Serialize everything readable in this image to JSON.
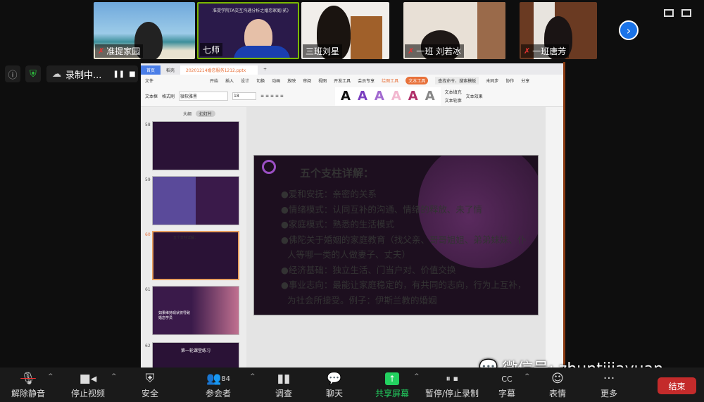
{
  "participants": [
    {
      "name": "准提家园",
      "muted": true
    },
    {
      "name": "七师",
      "muted": false,
      "slide_title": "准提学院TA交互沟通分析之婚恋家庭(贰)"
    },
    {
      "name": "三班刘星",
      "muted": false
    },
    {
      "name": "一班 刘若冰",
      "muted": true
    },
    {
      "name": "一班唐芳",
      "muted": true
    }
  ],
  "recording": {
    "label": "录制中..."
  },
  "wps": {
    "tabs": [
      "首页",
      "稻壳",
      "20201214婚恋服务1212.pptx"
    ],
    "menu": [
      "文件",
      "开始",
      "插入",
      "设计",
      "切换",
      "动画",
      "放映",
      "审阅",
      "视图",
      "开发工具",
      "会员专享",
      "绘图工具",
      "文本工具",
      "查找命令、搜索模板",
      "未同步",
      "协作",
      "分享"
    ],
    "ribbon": {
      "textbox": "文本框",
      "format_painter": "格式刷",
      "font": "微软雅黑",
      "size": "18",
      "fill": "文本填充",
      "outline": "文本轮廓",
      "effect": "文本效果"
    },
    "panel_tabs": [
      "大纲",
      "幻灯片"
    ],
    "slide_numbers": [
      "58",
      "59",
      "60",
      "61",
      "62"
    ],
    "thumb_61_text": "如果维持现状将导致\n婚恋学员",
    "thumb_62_text": "第一轮课堂练习"
  },
  "slide": {
    "title": "五个支柱详解：",
    "bullets": [
      "●爱和安抚：亲密的关系",
      "●情绪模式：认同互补的沟通、情绪的释放、未了情",
      "●家庭模式：熟悉的生活模式",
      "●佛陀关于婚姻的家庭教育（找父亲、哥哥姐姐、弟弟妹妹、仆人等哪一类的人做妻子、丈夫）",
      "●经济基础：独立生活、门当户对、价值交换",
      "●事业志向：最能让家庭稳定的，有共同的志向，行为上互补，为社会所接受。例子：伊斯兰教的婚姻"
    ]
  },
  "toolbar": {
    "unmute": "解除静音",
    "stop_video": "停止视频",
    "security": "安全",
    "participants": "参会者",
    "participants_count": "84",
    "poll": "调查",
    "chat": "聊天",
    "share": "共享屏幕",
    "record": "暂停/停止录制",
    "captions": "字幕",
    "reactions": "表情",
    "more": "更多",
    "end": "结束"
  },
  "watermark": "微信号: zhuntijiayuan",
  "colors": {
    "share_green": "#23d160",
    "end_red": "#c42b2b",
    "accent_orange": "#e8713a"
  }
}
